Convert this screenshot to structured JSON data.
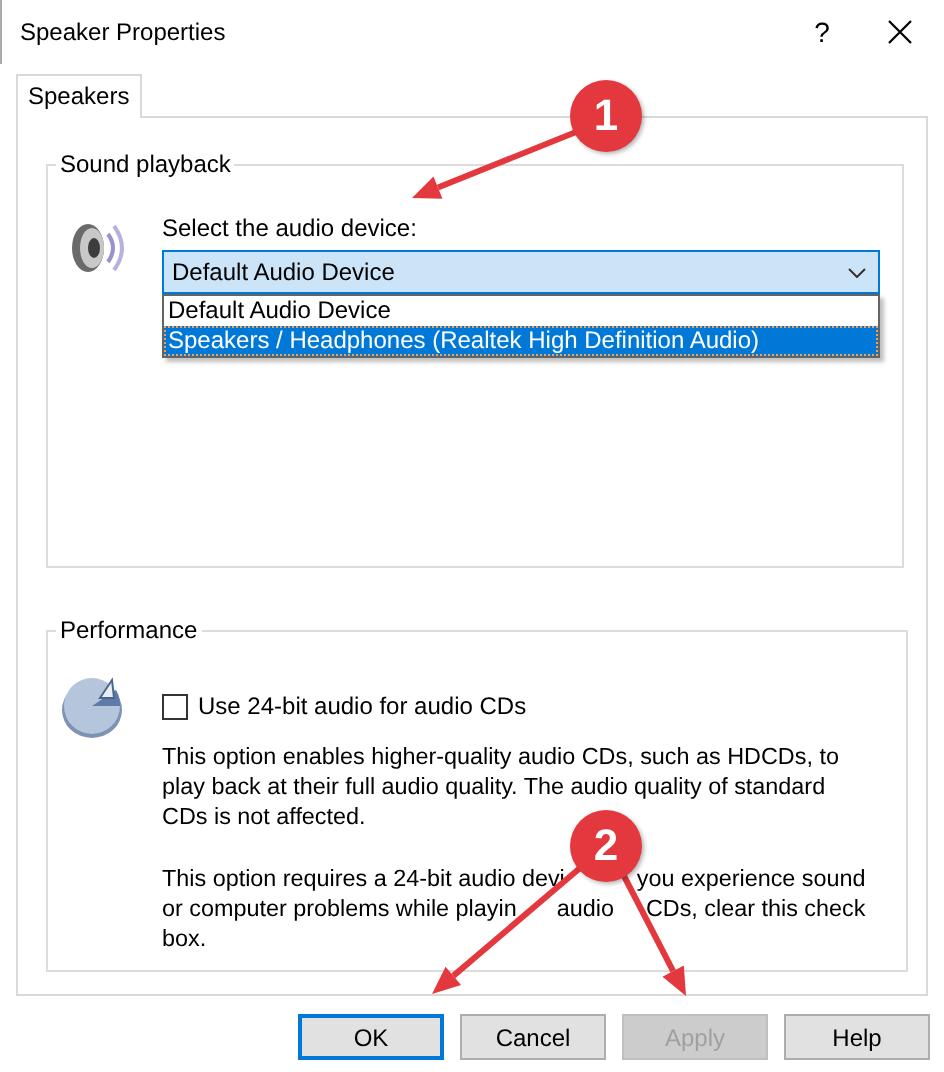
{
  "window": {
    "title": "Speaker Properties",
    "help_glyph": "?"
  },
  "tabs": [
    {
      "label": "Speakers",
      "selected": true
    }
  ],
  "sound_playback": {
    "title": "Sound playback",
    "prompt": "Select the audio device:",
    "dropdown": {
      "value": "Default Audio Device",
      "expanded": true
    },
    "options": [
      {
        "label": "Default Audio Device",
        "selected": false
      },
      {
        "label": "Speakers / Headphones (Realtek High Definition Audio)",
        "selected": true
      }
    ]
  },
  "performance": {
    "title": "Performance",
    "checkbox": {
      "label": "Use 24-bit audio for audio CDs",
      "checked": false
    },
    "paragraphs": [
      {
        "lines": [
          [
            "This option enables higher-quality audio CDs, such as HDCDs, to"
          ],
          [
            "play back at their full audio quality. The audio quality of standard"
          ],
          [
            "CDs is not affected."
          ]
        ]
      },
      {
        "lines": [
          [
            "This option requires a 24-bit audio devi",
            "you experience sound"
          ],
          [
            "or computer problems while playin",
            "audio",
            "CDs, clear this check"
          ],
          [
            "box."
          ]
        ]
      }
    ]
  },
  "buttons": [
    {
      "label": "OK",
      "default": true,
      "disabled": false
    },
    {
      "label": "Cancel",
      "default": false,
      "disabled": false
    },
    {
      "label": "Apply",
      "default": false,
      "disabled": true
    },
    {
      "label": "Help",
      "default": false,
      "disabled": false
    }
  ],
  "annotations": [
    {
      "number": "1"
    },
    {
      "number": "2"
    }
  ]
}
